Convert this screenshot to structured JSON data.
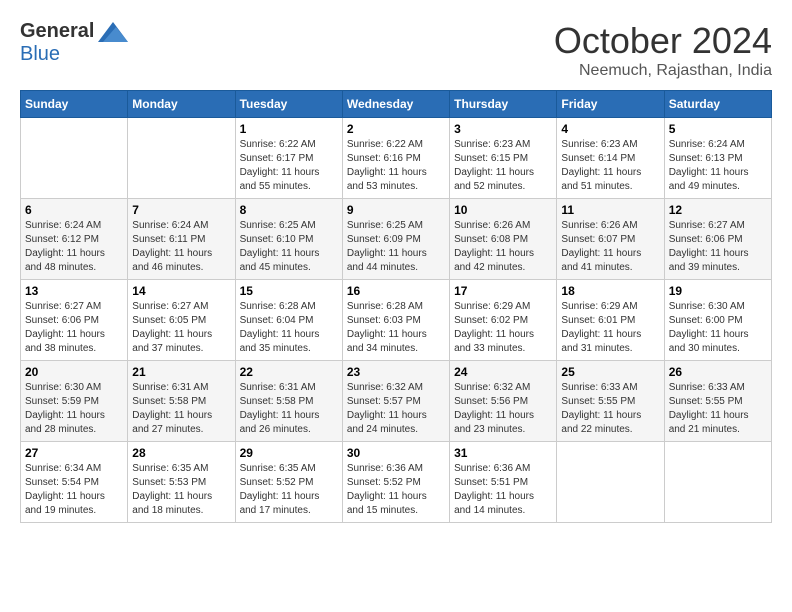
{
  "header": {
    "logo_general": "General",
    "logo_blue": "Blue",
    "month_title": "October 2024",
    "location": "Neemuch, Rajasthan, India"
  },
  "calendar": {
    "headers": [
      "Sunday",
      "Monday",
      "Tuesday",
      "Wednesday",
      "Thursday",
      "Friday",
      "Saturday"
    ],
    "weeks": [
      [
        {
          "day": "",
          "info": ""
        },
        {
          "day": "",
          "info": ""
        },
        {
          "day": "1",
          "info": "Sunrise: 6:22 AM\nSunset: 6:17 PM\nDaylight: 11 hours and 55 minutes."
        },
        {
          "day": "2",
          "info": "Sunrise: 6:22 AM\nSunset: 6:16 PM\nDaylight: 11 hours and 53 minutes."
        },
        {
          "day": "3",
          "info": "Sunrise: 6:23 AM\nSunset: 6:15 PM\nDaylight: 11 hours and 52 minutes."
        },
        {
          "day": "4",
          "info": "Sunrise: 6:23 AM\nSunset: 6:14 PM\nDaylight: 11 hours and 51 minutes."
        },
        {
          "day": "5",
          "info": "Sunrise: 6:24 AM\nSunset: 6:13 PM\nDaylight: 11 hours and 49 minutes."
        }
      ],
      [
        {
          "day": "6",
          "info": "Sunrise: 6:24 AM\nSunset: 6:12 PM\nDaylight: 11 hours and 48 minutes."
        },
        {
          "day": "7",
          "info": "Sunrise: 6:24 AM\nSunset: 6:11 PM\nDaylight: 11 hours and 46 minutes."
        },
        {
          "day": "8",
          "info": "Sunrise: 6:25 AM\nSunset: 6:10 PM\nDaylight: 11 hours and 45 minutes."
        },
        {
          "day": "9",
          "info": "Sunrise: 6:25 AM\nSunset: 6:09 PM\nDaylight: 11 hours and 44 minutes."
        },
        {
          "day": "10",
          "info": "Sunrise: 6:26 AM\nSunset: 6:08 PM\nDaylight: 11 hours and 42 minutes."
        },
        {
          "day": "11",
          "info": "Sunrise: 6:26 AM\nSunset: 6:07 PM\nDaylight: 11 hours and 41 minutes."
        },
        {
          "day": "12",
          "info": "Sunrise: 6:27 AM\nSunset: 6:06 PM\nDaylight: 11 hours and 39 minutes."
        }
      ],
      [
        {
          "day": "13",
          "info": "Sunrise: 6:27 AM\nSunset: 6:06 PM\nDaylight: 11 hours and 38 minutes."
        },
        {
          "day": "14",
          "info": "Sunrise: 6:27 AM\nSunset: 6:05 PM\nDaylight: 11 hours and 37 minutes."
        },
        {
          "day": "15",
          "info": "Sunrise: 6:28 AM\nSunset: 6:04 PM\nDaylight: 11 hours and 35 minutes."
        },
        {
          "day": "16",
          "info": "Sunrise: 6:28 AM\nSunset: 6:03 PM\nDaylight: 11 hours and 34 minutes."
        },
        {
          "day": "17",
          "info": "Sunrise: 6:29 AM\nSunset: 6:02 PM\nDaylight: 11 hours and 33 minutes."
        },
        {
          "day": "18",
          "info": "Sunrise: 6:29 AM\nSunset: 6:01 PM\nDaylight: 11 hours and 31 minutes."
        },
        {
          "day": "19",
          "info": "Sunrise: 6:30 AM\nSunset: 6:00 PM\nDaylight: 11 hours and 30 minutes."
        }
      ],
      [
        {
          "day": "20",
          "info": "Sunrise: 6:30 AM\nSunset: 5:59 PM\nDaylight: 11 hours and 28 minutes."
        },
        {
          "day": "21",
          "info": "Sunrise: 6:31 AM\nSunset: 5:58 PM\nDaylight: 11 hours and 27 minutes."
        },
        {
          "day": "22",
          "info": "Sunrise: 6:31 AM\nSunset: 5:58 PM\nDaylight: 11 hours and 26 minutes."
        },
        {
          "day": "23",
          "info": "Sunrise: 6:32 AM\nSunset: 5:57 PM\nDaylight: 11 hours and 24 minutes."
        },
        {
          "day": "24",
          "info": "Sunrise: 6:32 AM\nSunset: 5:56 PM\nDaylight: 11 hours and 23 minutes."
        },
        {
          "day": "25",
          "info": "Sunrise: 6:33 AM\nSunset: 5:55 PM\nDaylight: 11 hours and 22 minutes."
        },
        {
          "day": "26",
          "info": "Sunrise: 6:33 AM\nSunset: 5:55 PM\nDaylight: 11 hours and 21 minutes."
        }
      ],
      [
        {
          "day": "27",
          "info": "Sunrise: 6:34 AM\nSunset: 5:54 PM\nDaylight: 11 hours and 19 minutes."
        },
        {
          "day": "28",
          "info": "Sunrise: 6:35 AM\nSunset: 5:53 PM\nDaylight: 11 hours and 18 minutes."
        },
        {
          "day": "29",
          "info": "Sunrise: 6:35 AM\nSunset: 5:52 PM\nDaylight: 11 hours and 17 minutes."
        },
        {
          "day": "30",
          "info": "Sunrise: 6:36 AM\nSunset: 5:52 PM\nDaylight: 11 hours and 15 minutes."
        },
        {
          "day": "31",
          "info": "Sunrise: 6:36 AM\nSunset: 5:51 PM\nDaylight: 11 hours and 14 minutes."
        },
        {
          "day": "",
          "info": ""
        },
        {
          "day": "",
          "info": ""
        }
      ]
    ]
  }
}
